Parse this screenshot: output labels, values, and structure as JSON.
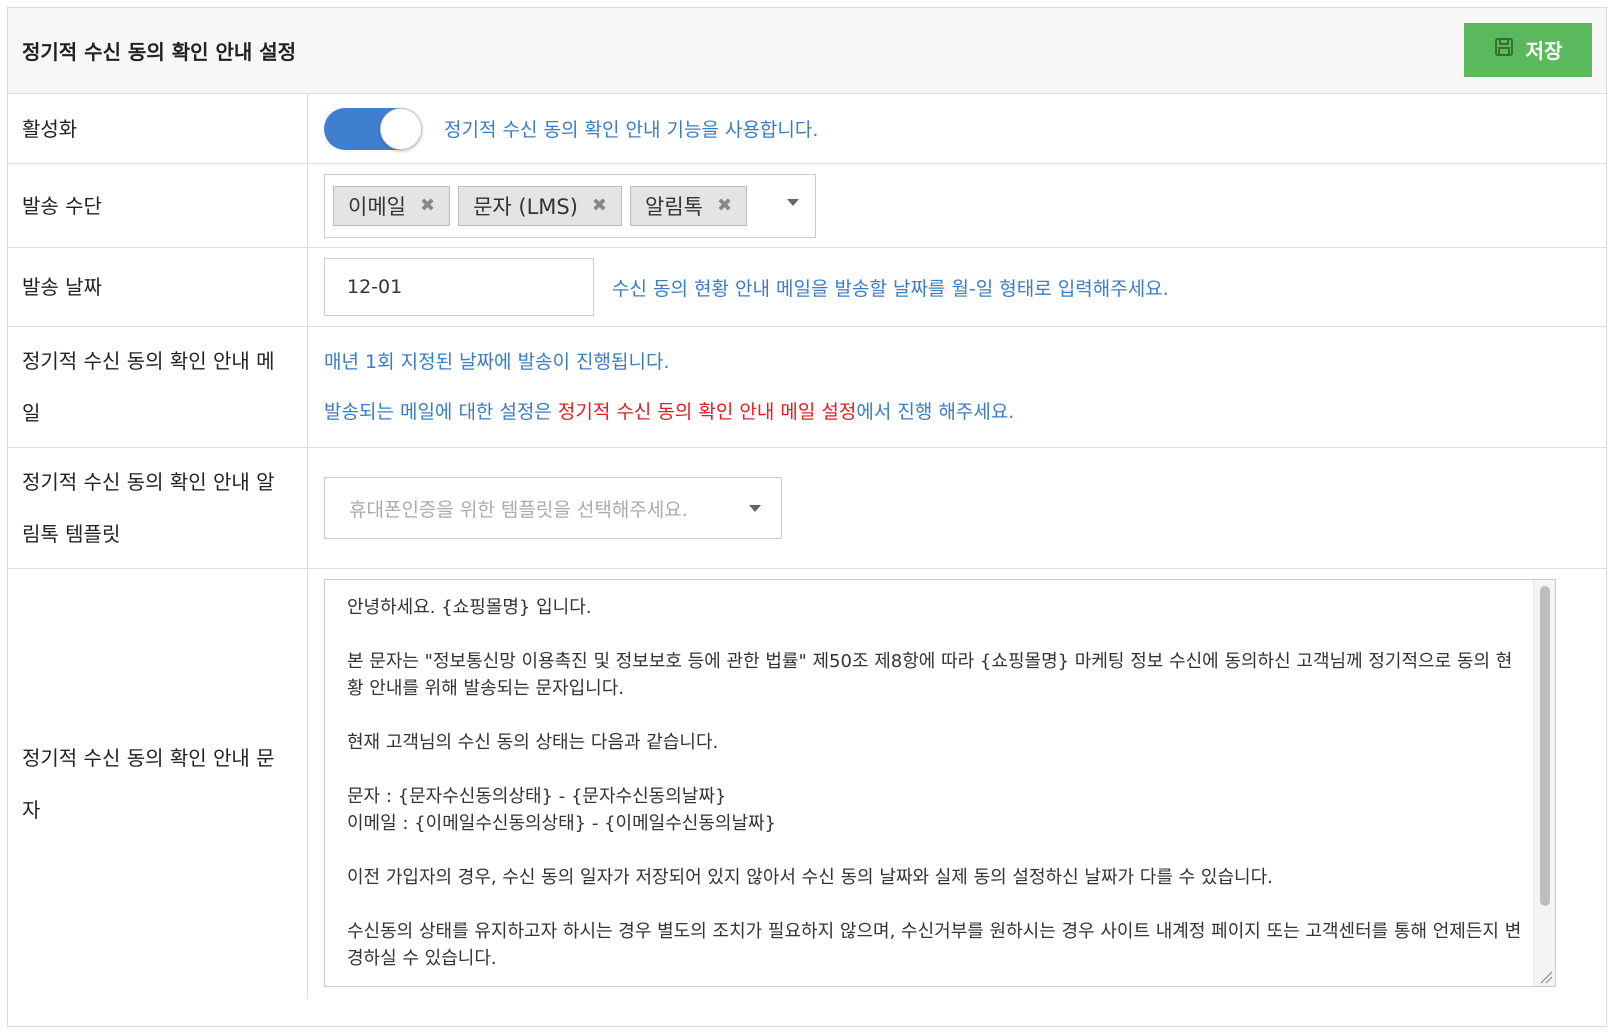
{
  "header": {
    "title": "정기적 수신 동의 확인 안내 설정",
    "save_label": "저장",
    "save_icon": "floppy-disk-icon",
    "save_color": "#5cb85c"
  },
  "rows": {
    "activation": {
      "label": "활성화",
      "toggle_on": true,
      "hint": "정기적 수신 동의 확인 안내 기능을 사용합니다."
    },
    "send_method": {
      "label": "발송 수단",
      "tags": [
        "이메일",
        "문자 (LMS)",
        "알림톡"
      ]
    },
    "send_date": {
      "label": "발송 날짜",
      "value": "12-01",
      "hint": "수신 동의 현황 안내 메일을 발송할 날짜를 월-일 형태로 입력해주세요."
    },
    "mail": {
      "label": "정기적 수신 동의 확인 안내 메일",
      "line1": "매년 1회 지정된 날짜에 발송이 진행됩니다.",
      "line2_prefix": "발송되는 메일에 대한 설정은 ",
      "line2_link": "정기적 수신 동의 확인 안내 메일 설정",
      "line2_suffix": "에서 진행 해주세요."
    },
    "alimtalk": {
      "label": "정기적 수신 동의 확인 안내 알림톡 템플릿",
      "placeholder": "휴대폰인증을 위한 템플릿을 선택해주세요."
    },
    "sms": {
      "label": "정기적 수신 동의 확인 안내 문자",
      "text": "안녕하세요. {쇼핑몰명} 입니다.\n\n본 문자는 \"정보통신망 이용촉진 및 정보보호 등에 관한 법률\" 제50조 제8항에 따라 {쇼핑몰명} 마케팅 정보 수신에 동의하신 고객님께 정기적으로 동의 현황 안내를 위해 발송되는 문자입니다.\n\n현재 고객님의 수신 동의 상태는 다음과 같습니다.\n\n문자 : {문자수신동의상태} - {문자수신동의날짜}\n이메일 : {이메일수신동의상태} - {이메일수신동의날짜}\n\n이전 가입자의 경우, 수신 동의 일자가 저장되어 있지 않아서 수신 동의 날짜와 실제 동의 설정하신 날짜가 다를 수 있습니다.\n\n수신동의 상태를 유지하고자 하시는 경우 별도의 조치가 필요하지 않으며, 수신거부를 원하시는 경우 사이트 내계정 페이지 또는 고객센터를 통해 언제든지 변경하실 수 있습니다."
    }
  },
  "colors": {
    "accent_blue": "#3f7fcf",
    "hint_blue": "#3b7dc4",
    "link_red": "#e02020"
  }
}
